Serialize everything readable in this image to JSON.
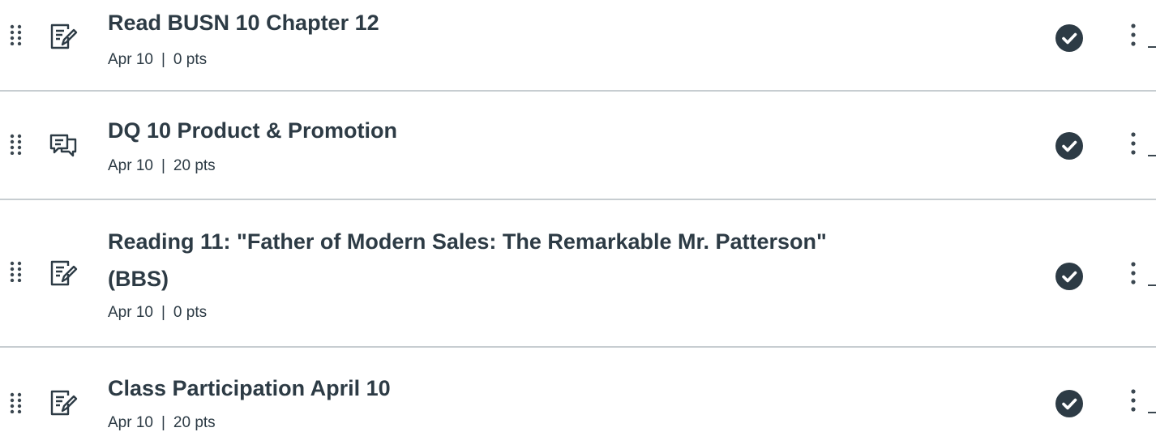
{
  "modules": {
    "items": [
      {
        "icon": "assignment-icon",
        "title": "Read BUSN 10 Chapter 12",
        "title_line2": "",
        "date": "Apr 10",
        "separator": "|",
        "points": "0 pts",
        "status": "published-check-icon"
      },
      {
        "icon": "discussion-icon",
        "title": "DQ 10 Product & Promotion",
        "title_line2": "",
        "date": "Apr 10",
        "separator": "|",
        "points": "20 pts",
        "status": "published-check-icon"
      },
      {
        "icon": "assignment-icon",
        "title": "Reading 11: \"Father of Modern Sales: The Remarkable Mr. Patterson\"",
        "title_line2": "(BBS)",
        "date": "Apr 10",
        "separator": "|",
        "points": "0 pts",
        "status": "published-check-icon"
      },
      {
        "icon": "assignment-icon",
        "title": "Class Participation April 10",
        "title_line2": "",
        "date": "Apr 10",
        "separator": "|",
        "points": "20 pts",
        "status": "published-check-icon"
      }
    ]
  },
  "colors": {
    "text": "#2d3b45",
    "divider": "#c7cdd1",
    "status_badge": "#2d3b45"
  }
}
